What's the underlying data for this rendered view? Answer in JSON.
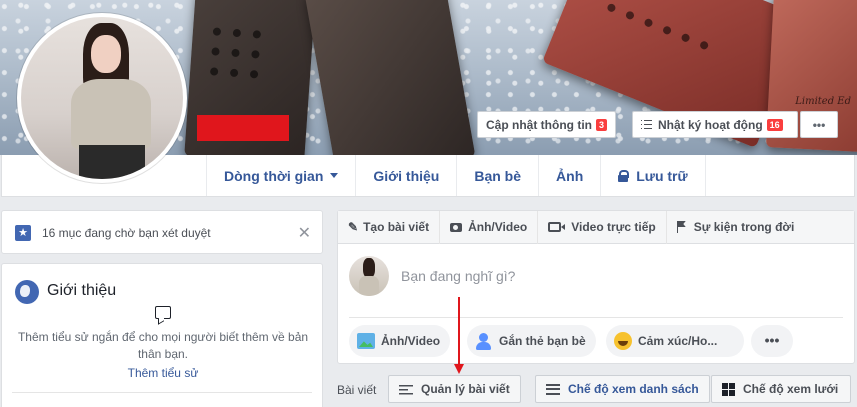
{
  "cover": {
    "board_text": "Limited Ed",
    "buttons": {
      "update_info": "Cập nhật thông tin",
      "update_info_badge": "3",
      "activity_log": "Nhật ký hoạt động",
      "activity_log_badge": "16",
      "more": "•••"
    }
  },
  "nav": {
    "items": [
      {
        "label": "Dòng thời gian"
      },
      {
        "label": "Giới thiệu"
      },
      {
        "label": "Bạn bè"
      },
      {
        "label": "Ảnh"
      },
      {
        "label": "Lưu trữ"
      }
    ]
  },
  "pending": {
    "icon": "★",
    "text": "16 mục đang chờ bạn xét duyệt",
    "close": "✕"
  },
  "intro": {
    "title": "Giới thiệu",
    "description": "Thêm tiểu sử ngắn để cho mọi người biết thêm về bản thân bạn.",
    "link": "Thêm tiểu sử"
  },
  "composer": {
    "tabs": [
      {
        "label": "Tạo bài viết",
        "icon": "pencil-icon"
      },
      {
        "label": "Ảnh/Video",
        "icon": "camera-icon"
      },
      {
        "label": "Video trực tiếp",
        "icon": "video-icon"
      },
      {
        "label": "Sự kiện trong đời",
        "icon": "flag-icon"
      }
    ],
    "pencil_glyph": "✎",
    "placeholder": "Bạn đang nghĩ gì?",
    "actions": {
      "photo": "Ảnh/Video",
      "tag": "Gắn thẻ bạn bè",
      "feeling": "Cảm xúc/Ho...",
      "more": "•••"
    }
  },
  "posts_bar": {
    "label": "Bài viết",
    "manage": "Quản lý bài viết",
    "list_view": "Chế độ xem danh sách",
    "grid_view": "Chế độ xem lưới"
  },
  "colors": {
    "fb_blue": "#4267b2",
    "link_blue": "#365899",
    "badge_red": "#fa3e3e",
    "annotation_red": "#e0161c"
  }
}
